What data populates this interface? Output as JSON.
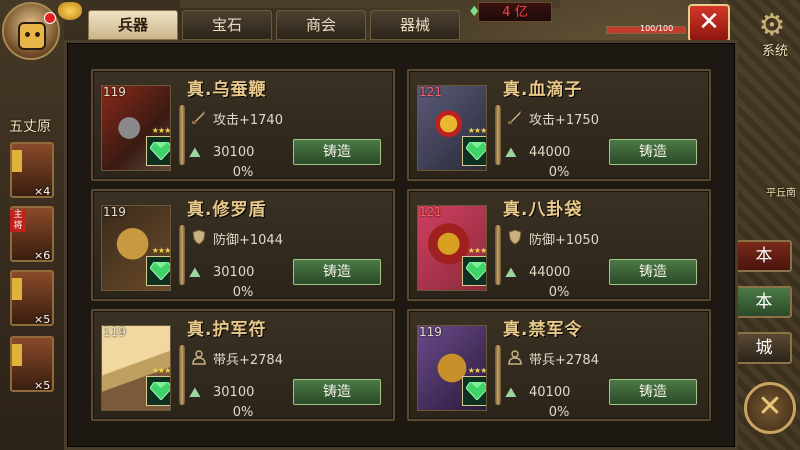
{
  "currency": {
    "amount": "4 亿"
  },
  "hp_text": "100/100",
  "tabs": [
    {
      "label": "兵器",
      "active": true
    },
    {
      "label": "宝石",
      "active": false
    },
    {
      "label": "商会",
      "active": false
    },
    {
      "label": "器械",
      "active": false
    }
  ],
  "system": {
    "label": "系统"
  },
  "left": {
    "location": "五丈原",
    "heroes": [
      {
        "count": "×4"
      },
      {
        "badge": "主将",
        "count": "×6"
      },
      {
        "count": "×5"
      },
      {
        "count": "×5"
      }
    ]
  },
  "right": {
    "city_label": "平丘南",
    "buttons": [
      "本",
      "本",
      "城"
    ]
  },
  "items": [
    {
      "level": "119",
      "name": "真.乌蚕鞭",
      "stat_icon": "sword-icon",
      "stat": "攻击+1740",
      "cost": "30100",
      "forge_label": "铸造",
      "percent": "0%",
      "stars": "★★★"
    },
    {
      "level": "121",
      "name": "真.血滴子",
      "stat_icon": "sword-icon",
      "stat": "攻击+1750",
      "cost": "44000",
      "forge_label": "铸造",
      "percent": "0%",
      "stars": "★★★"
    },
    {
      "level": "119",
      "name": "真.修罗盾",
      "stat_icon": "shield-icon",
      "stat": "防御+1044",
      "cost": "30100",
      "forge_label": "铸造",
      "percent": "0%",
      "stars": "★★★"
    },
    {
      "level": "121",
      "name": "真.八卦袋",
      "stat_icon": "shield-icon",
      "stat": "防御+1050",
      "cost": "44000",
      "forge_label": "铸造",
      "percent": "0%",
      "stars": "★★★"
    },
    {
      "level": "119",
      "name": "真.护军符",
      "stat_icon": "soldier-icon",
      "stat": "带兵+2784",
      "cost": "30100",
      "forge_label": "铸造",
      "percent": "0%",
      "stars": "★★★"
    },
    {
      "level": "119",
      "name": "真.禁军令",
      "stat_icon": "soldier-icon",
      "stat": "带兵+2784",
      "cost": "40100",
      "forge_label": "铸造",
      "percent": "0%",
      "stars": "★★★"
    }
  ],
  "colors": {
    "accent_gold": "#e8c98a",
    "forge_green": "#4c7a47",
    "level_red": "#ff6060",
    "close_red": "#d2372a"
  }
}
